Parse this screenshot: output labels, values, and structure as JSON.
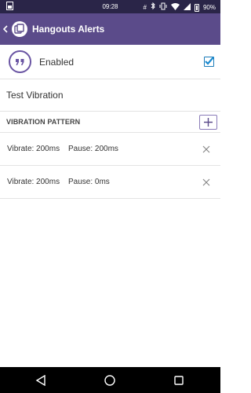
{
  "status_bar": {
    "time": "09:28",
    "battery": "90%",
    "icons": [
      "notification-icon",
      "hash-icon",
      "bluetooth-icon",
      "vibrate-icon",
      "wifi-icon",
      "signal-icon",
      "battery-icon"
    ]
  },
  "app_bar": {
    "title": "Hangouts Alerts",
    "color": "#5b4b8a"
  },
  "enabled_row": {
    "label": "Enabled",
    "checked": true
  },
  "test_row": {
    "label": "Test Vibration"
  },
  "section": {
    "title": "VIBRATION PATTERN",
    "add_label": "+"
  },
  "patterns": [
    {
      "vibrate": "Vibrate: 200ms",
      "pause": "Pause: 200ms"
    },
    {
      "vibrate": "Vibrate: 200ms",
      "pause": "Pause: 0ms"
    }
  ],
  "nav": {
    "icons": [
      "back-nav-icon",
      "home-nav-icon",
      "recents-nav-icon"
    ]
  }
}
